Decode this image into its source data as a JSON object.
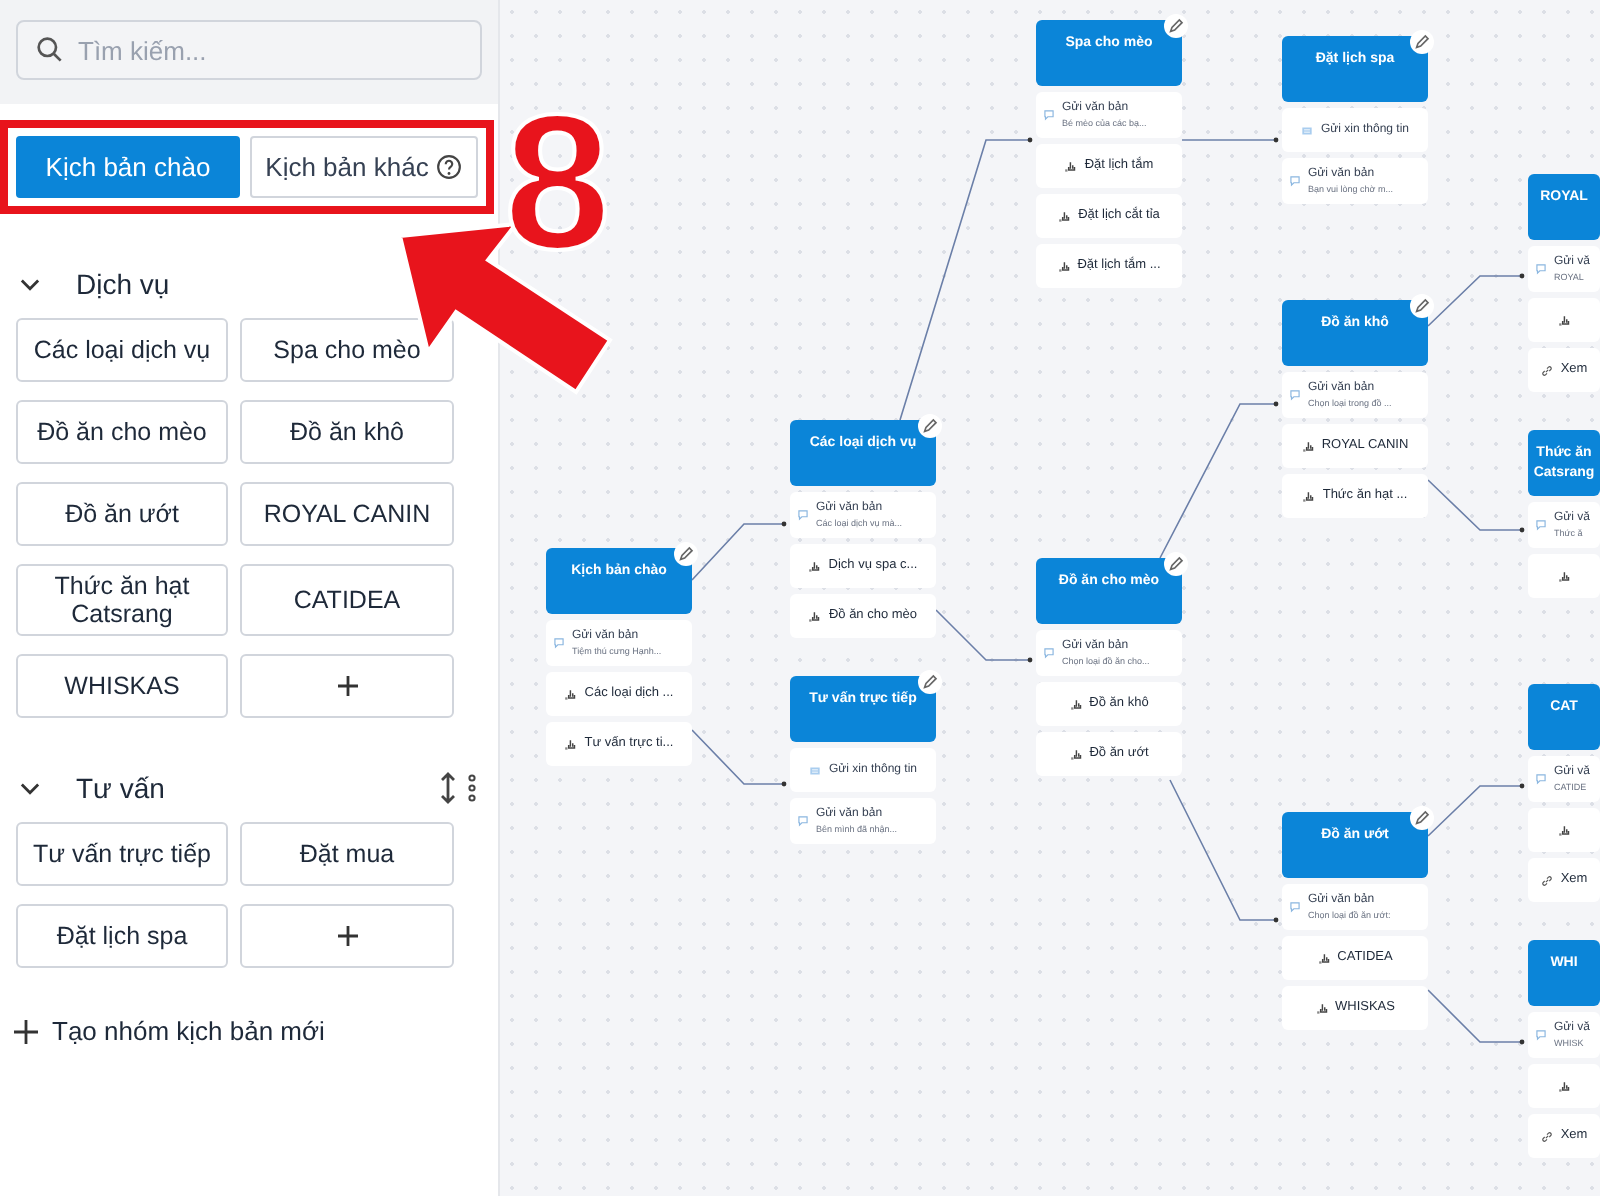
{
  "search": {
    "placeholder": "Tìm kiếm..."
  },
  "tabs": [
    {
      "label": "Kịch bản chào",
      "selected": true,
      "help": false
    },
    {
      "label": "Kịch bản khác",
      "selected": false,
      "help": true
    }
  ],
  "annotation": {
    "number": "8"
  },
  "groups": [
    {
      "title": "Dịch vụ",
      "expanded": true,
      "tools": false,
      "items": [
        "Các loại dịch vụ",
        "Spa cho mèo",
        "Đồ ăn cho mèo",
        "Đồ ăn khô",
        "Đồ ăn ướt",
        "ROYAL CANIN",
        "Thức ăn hạt Catsrang",
        "CATIDEA",
        "WHISKAS"
      ]
    },
    {
      "title": "Tư vấn",
      "expanded": true,
      "tools": true,
      "items": [
        "Tư vấn trực tiếp",
        "Đặt mua",
        "Đặt lịch spa"
      ]
    }
  ],
  "new_group": "Tạo nhóm kịch bản mới",
  "nodes": [
    {
      "title": "Kịch bản chào",
      "items": [
        {
          "kind": "text",
          "title": "Gửi văn bản",
          "text": "Tiệm thú cưng Hạnh..."
        },
        {
          "kind": "button",
          "label": "Các loại dịch ..."
        },
        {
          "kind": "button",
          "label": "Tư vấn trực ti..."
        }
      ]
    },
    {
      "title": "Các loại dịch vụ",
      "items": [
        {
          "kind": "text",
          "title": "Gửi văn bản",
          "text": "Các loại dịch vụ mà..."
        },
        {
          "kind": "button",
          "label": "Dịch vụ spa c..."
        },
        {
          "kind": "button",
          "label": "Đồ ăn cho mèo"
        }
      ]
    },
    {
      "title": "Tư vấn trực tiếp",
      "items": [
        {
          "kind": "form",
          "label": "Gửi xin thông tin"
        },
        {
          "kind": "text",
          "title": "Gửi văn bản",
          "text": "Bên mình đã nhận..."
        }
      ]
    },
    {
      "title": "Spa cho mèo",
      "items": [
        {
          "kind": "text",
          "title": "Gửi văn bản",
          "text": "Bé mèo của các bạ..."
        },
        {
          "kind": "button",
          "label": "Đặt lịch tắm"
        },
        {
          "kind": "button",
          "label": "Đặt lịch cắt tỉa"
        },
        {
          "kind": "button",
          "label": "Đặt lịch tắm ..."
        }
      ]
    },
    {
      "title": "Đồ ăn cho mèo",
      "items": [
        {
          "kind": "text",
          "title": "Gửi văn bản",
          "text": "Chọn loại đồ ăn cho..."
        },
        {
          "kind": "button",
          "label": "Đồ ăn khô"
        },
        {
          "kind": "button",
          "label": "Đồ ăn ướt"
        }
      ]
    },
    {
      "title": "Đặt lịch spa",
      "items": [
        {
          "kind": "form",
          "label": "Gửi xin thông tin"
        },
        {
          "kind": "text",
          "title": "Gửi văn bản",
          "text": "Bạn vui lòng chờ m..."
        }
      ]
    },
    {
      "title": "Đồ ăn khô",
      "items": [
        {
          "kind": "text",
          "title": "Gửi văn bản",
          "text": "Chọn loại trong đồ ..."
        },
        {
          "kind": "button",
          "label": "ROYAL CANIN"
        },
        {
          "kind": "button",
          "label": "Thức ăn hạt ..."
        }
      ]
    },
    {
      "title": "Đồ ăn ướt",
      "items": [
        {
          "kind": "text",
          "title": "Gửi văn bản",
          "text": "Chọn loại đồ ăn ướt:"
        },
        {
          "kind": "button",
          "label": "CATIDEA"
        },
        {
          "kind": "button",
          "label": "WHISKAS"
        }
      ]
    },
    {
      "title": "ROYAL",
      "items": [
        {
          "kind": "text",
          "title": "Gửi vă",
          "text": "ROYAL"
        },
        {
          "kind": "button"
        },
        {
          "kind": "link",
          "label": "Xem"
        }
      ]
    },
    {
      "title": "Thức ăn Catsrang",
      "items": [
        {
          "kind": "text",
          "title": "Gửi vă",
          "text": "Thức ă"
        },
        {
          "kind": "button"
        }
      ]
    },
    {
      "title": "CAT",
      "items": [
        {
          "kind": "text",
          "title": "Gửi vă",
          "text": "CATIDE"
        },
        {
          "kind": "button"
        },
        {
          "kind": "link",
          "label": "Xem"
        }
      ]
    },
    {
      "title": "WHI",
      "items": [
        {
          "kind": "text",
          "title": "Gửi vă",
          "text": "WHISK"
        },
        {
          "kind": "button"
        },
        {
          "kind": "link",
          "label": "Xem"
        }
      ]
    }
  ]
}
